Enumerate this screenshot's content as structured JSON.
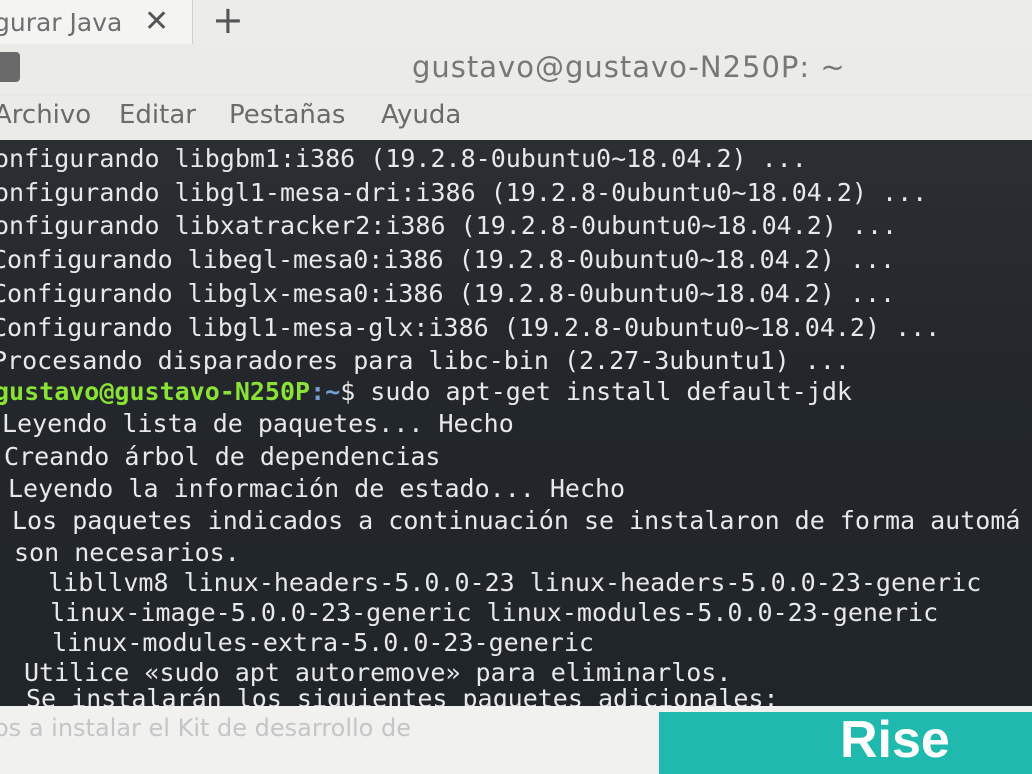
{
  "tab": {
    "title": "gurar Java",
    "close_glyph": "✕",
    "new_tab_glyph": "+"
  },
  "window": {
    "title": "gustavo@gustavo-N250P: ~"
  },
  "menu": {
    "items": [
      "Archivo",
      "Editar",
      "Pestañas",
      "Ayuda"
    ]
  },
  "terminal": {
    "lines": [
      "onfigurando libgbm1:i386 (19.2.8-0ubuntu0~18.04.2) ...",
      "onfigurando libgl1-mesa-dri:i386 (19.2.8-0ubuntu0~18.04.2) ...",
      "onfigurando libxatracker2:i386 (19.2.8-0ubuntu0~18.04.2) ...",
      "Configurando libegl-mesa0:i386 (19.2.8-0ubuntu0~18.04.2) ...",
      "Configurando libglx-mesa0:i386 (19.2.8-0ubuntu0~18.04.2) ...",
      "Configurando libgl1-mesa-glx:i386 (19.2.8-0ubuntu0~18.04.2) ...",
      "Procesando disparadores para libc-bin (2.27-3ubuntu1) ..."
    ],
    "prompt_user": "gustavo@gustavo-N250P",
    "prompt_path": ":~",
    "prompt_symbol": "$",
    "command": " sudo apt-get install default-jdk",
    "output": [
      "Leyendo lista de paquetes... Hecho",
      "Creando árbol de dependencias",
      "Leyendo la información de estado... Hecho",
      "Los paquetes indicados a continuación se instalaron de forma automá",
      "son necesarios.",
      "  libllvm8 linux-headers-5.0.0-23 linux-headers-5.0.0-23-generic",
      "  linux-image-5.0.0-23-generic linux-modules-5.0.0-23-generic",
      "  linux-modules-extra-5.0.0-23-generic",
      "Utilice «sudo apt autoremove» para eliminarlos.",
      "Se instalarán los siguientes paquetes adicionales:"
    ]
  },
  "background_page": {
    "text": "os a instalar el Kit de desarrollo de",
    "card_text": "Rise"
  },
  "colors": {
    "terminal_bg": "#262a2e",
    "prompt_green": "#8ae234",
    "path_blue": "#729fcf",
    "card_teal": "#20b9ad"
  }
}
